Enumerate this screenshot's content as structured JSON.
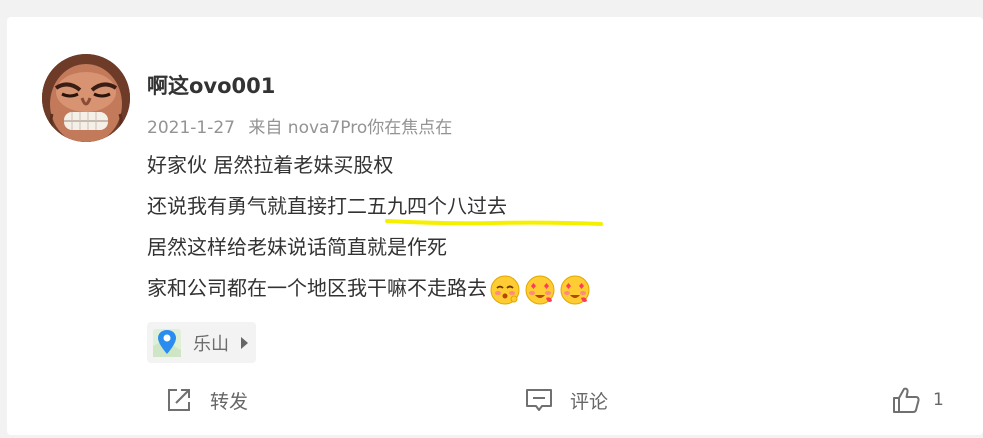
{
  "post": {
    "username": "啊这ovo001",
    "date": "2021-1-27",
    "source": "来自 nova7Pro你在焦点在",
    "lines": [
      "好家伙 居然拉着老妹买股权",
      "还说我有勇气就直接打二五九四个八过去",
      "居然这样给老妹说话简直就是作死",
      "家和公司都在一个地区我干嘛不走路去"
    ],
    "emojis": [
      "shy-face-emoji",
      "love-face-emoji",
      "love-face-emoji"
    ],
    "highlight_color": "#f5f000",
    "location": "乐山"
  },
  "actions": {
    "forward_label": "转发",
    "comment_label": "评论",
    "like_count": "1"
  }
}
